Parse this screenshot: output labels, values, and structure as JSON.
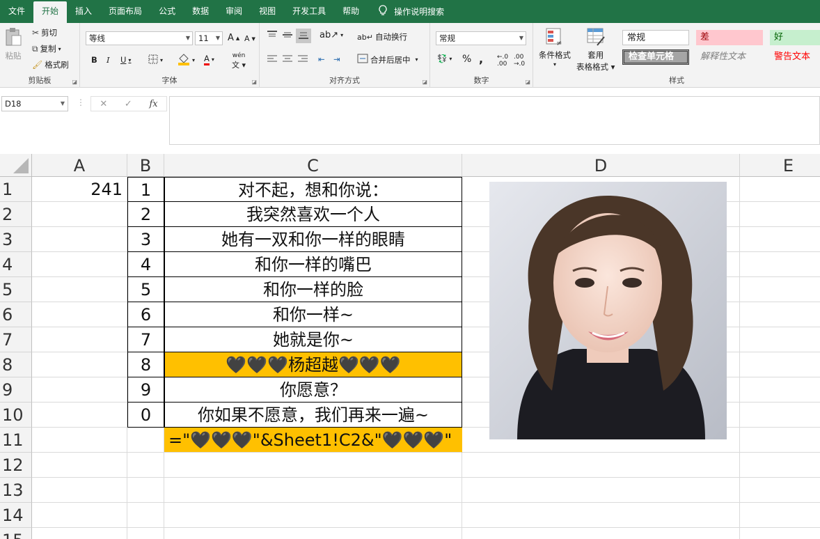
{
  "menu": {
    "tabs": [
      "文件",
      "开始",
      "插入",
      "页面布局",
      "公式",
      "数据",
      "审阅",
      "视图",
      "开发工具",
      "帮助"
    ],
    "active_tab": "开始",
    "tell_me": "操作说明搜索"
  },
  "ribbon": {
    "clipboard": {
      "label": "剪贴板",
      "paste": "粘贴",
      "cut": "剪切",
      "copy": "复制",
      "format_painter": "格式刷"
    },
    "font": {
      "label": "字体",
      "name": "等线",
      "size": "11",
      "bold": "B",
      "italic": "I",
      "underline": "U",
      "grow": "A",
      "shrink": "A",
      "font_color": "A",
      "wen": "wén"
    },
    "alignment": {
      "label": "对齐方式",
      "wrap": "自动换行",
      "merge": "合并后居中"
    },
    "number": {
      "label": "数字",
      "format": "常规",
      "percent": "%",
      "comma": ","
    },
    "styles": {
      "label": "样式",
      "conditional": "条件格式",
      "table_line1": "套用",
      "table_line2": "表格格式",
      "normal": "常规",
      "bad": "差",
      "good": "好",
      "check_cell": "检查单元格",
      "explanatory": "解释性文本",
      "warning": "警告文本"
    }
  },
  "formula_bar": {
    "name_box": "D18",
    "cancel": "✕",
    "enter": "✓",
    "fx": "fx",
    "content": ""
  },
  "columns": [
    "A",
    "B",
    "C",
    "D",
    "E"
  ],
  "rows": [
    "1",
    "2",
    "3",
    "4",
    "5",
    "6",
    "7",
    "8",
    "9",
    "10",
    "11",
    "12",
    "13",
    "14",
    "15"
  ],
  "cells": {
    "A1": "241",
    "B": [
      "1",
      "2",
      "3",
      "4",
      "5",
      "6",
      "7",
      "8",
      "9",
      "0"
    ],
    "C": [
      "对不起，想和你说：",
      "我突然喜欢一个人",
      "她有一双和你一样的眼睛",
      "和你一样的嘴巴",
      "和你一样的脸",
      "和你一样~",
      "她就是你~",
      "🖤🖤🖤杨超越🖤🖤🖤",
      "你愿意？",
      "你如果不愿意，我们再来一遍~"
    ],
    "C11": "=\"🖤🖤🖤\"&Sheet1!C2&\"🖤🖤🖤\""
  },
  "colors": {
    "accent": "#217346",
    "highlight": "#ffc000"
  }
}
